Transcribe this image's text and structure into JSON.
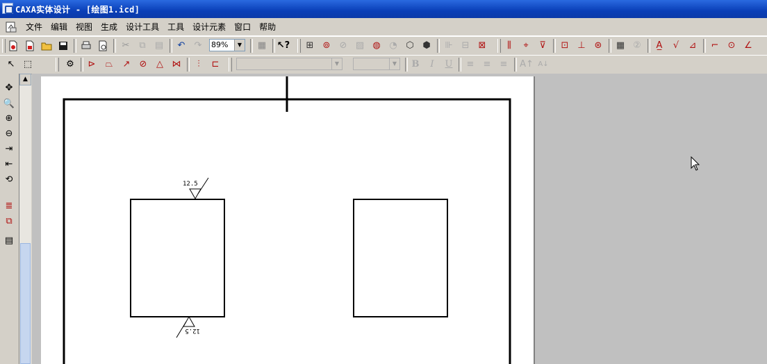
{
  "window": {
    "title": "CAXA实体设计 - [绘图1.icd]"
  },
  "menu": {
    "items": [
      "文件",
      "编辑",
      "视图",
      "生成",
      "设计工具",
      "工具",
      "设计元素",
      "窗口",
      "帮助"
    ]
  },
  "toolbar": {
    "zoom_value": "89%",
    "font_style_buttons": [
      "B",
      "I",
      "U"
    ]
  },
  "drawing": {
    "roughness_top": "12.5",
    "roughness_bottom": "12.5"
  },
  "colors": {
    "titlebar": "#0a3fb8",
    "chrome": "#d4d0c8",
    "workspace": "#c0c0c0",
    "paper": "#ffffff"
  }
}
